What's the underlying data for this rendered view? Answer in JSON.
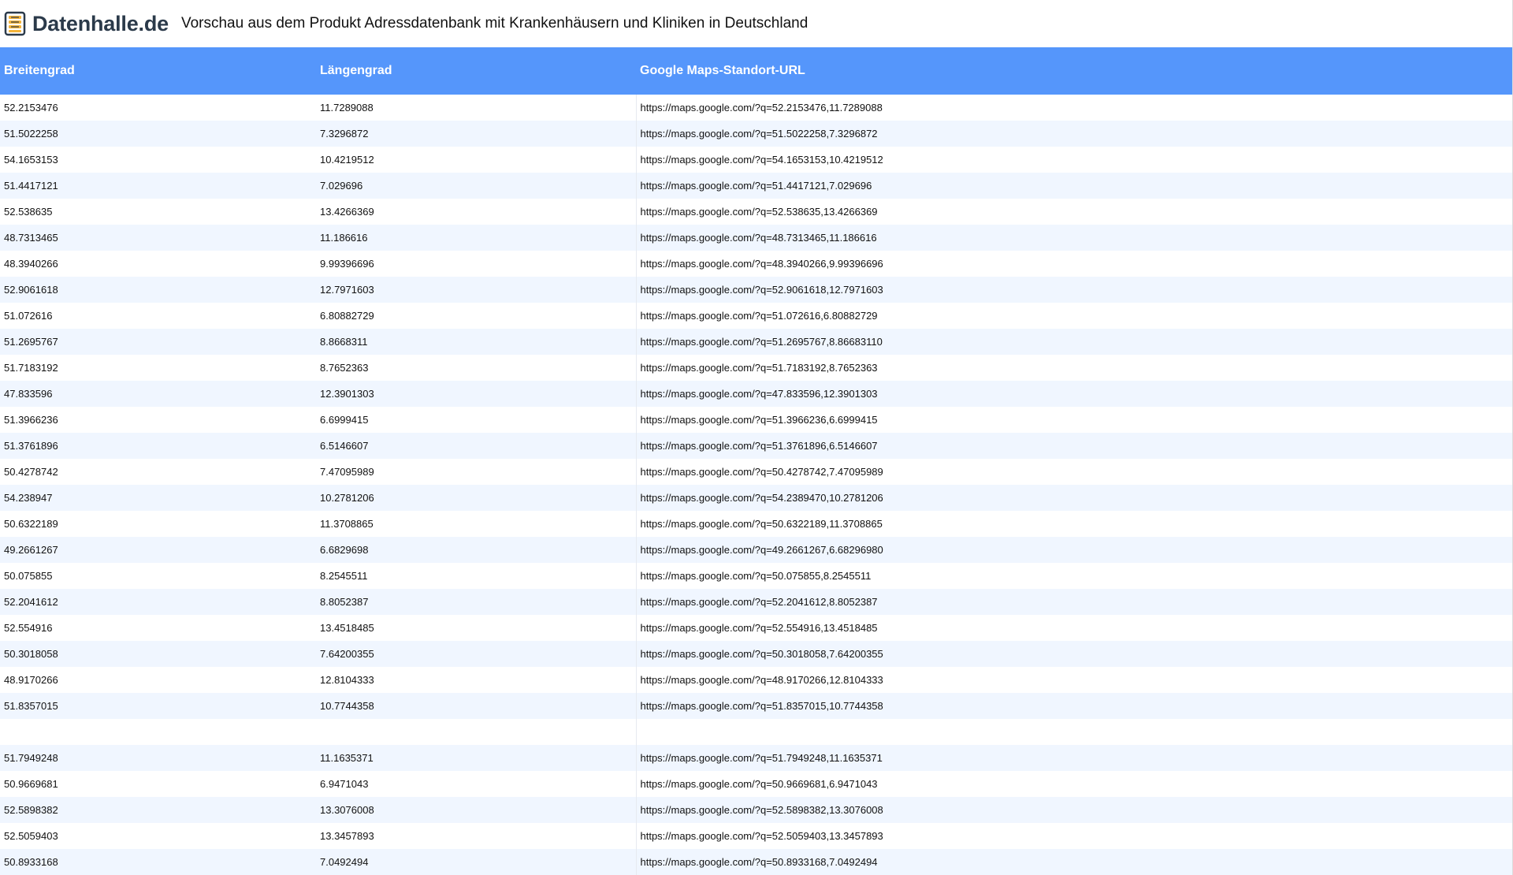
{
  "header": {
    "logo_text": "Datenhalle.de",
    "title": "Vorschau aus dem Produkt Adressdatenbank mit Krankenhäusern und Kliniken in Deutschland",
    "logo_icon": "database-stack-icon"
  },
  "colors": {
    "header_bg": "#5596fb",
    "row_alt": "#f0f6ff"
  },
  "table": {
    "columns": [
      "Breitengrad",
      "Längengrad",
      "Google Maps-Standort-URL"
    ],
    "rows": [
      [
        "52.2153476",
        "11.7289088",
        "https://maps.google.com/?q=52.2153476,11.7289088"
      ],
      [
        "51.5022258",
        "7.3296872",
        "https://maps.google.com/?q=51.5022258,7.3296872"
      ],
      [
        "54.1653153",
        "10.4219512",
        "https://maps.google.com/?q=54.1653153,10.4219512"
      ],
      [
        "51.4417121",
        "7.029696",
        "https://maps.google.com/?q=51.4417121,7.029696"
      ],
      [
        "52.538635",
        "13.4266369",
        "https://maps.google.com/?q=52.538635,13.4266369"
      ],
      [
        "48.7313465",
        "11.186616",
        "https://maps.google.com/?q=48.7313465,11.186616"
      ],
      [
        "48.3940266",
        "9.99396696",
        "https://maps.google.com/?q=48.3940266,9.99396696"
      ],
      [
        "52.9061618",
        "12.7971603",
        "https://maps.google.com/?q=52.9061618,12.7971603"
      ],
      [
        "51.072616",
        "6.80882729",
        "https://maps.google.com/?q=51.072616,6.80882729"
      ],
      [
        "51.2695767",
        "8.8668311",
        "https://maps.google.com/?q=51.2695767,8.86683110"
      ],
      [
        "51.7183192",
        "8.7652363",
        "https://maps.google.com/?q=51.7183192,8.7652363"
      ],
      [
        "47.833596",
        "12.3901303",
        "https://maps.google.com/?q=47.833596,12.3901303"
      ],
      [
        "51.3966236",
        "6.6999415",
        "https://maps.google.com/?q=51.3966236,6.6999415"
      ],
      [
        "51.3761896",
        "6.5146607",
        "https://maps.google.com/?q=51.3761896,6.5146607"
      ],
      [
        "50.4278742",
        "7.47095989",
        "https://maps.google.com/?q=50.4278742,7.47095989"
      ],
      [
        "54.238947",
        "10.2781206",
        "https://maps.google.com/?q=54.2389470,10.2781206"
      ],
      [
        "50.6322189",
        "11.3708865",
        "https://maps.google.com/?q=50.6322189,11.3708865"
      ],
      [
        "49.2661267",
        "6.6829698",
        "https://maps.google.com/?q=49.2661267,6.68296980"
      ],
      [
        "50.075855",
        "8.2545511",
        "https://maps.google.com/?q=50.075855,8.2545511"
      ],
      [
        "52.2041612",
        "8.8052387",
        "https://maps.google.com/?q=52.2041612,8.8052387"
      ],
      [
        "52.554916",
        "13.4518485",
        "https://maps.google.com/?q=52.554916,13.4518485"
      ],
      [
        "50.3018058",
        "7.64200355",
        "https://maps.google.com/?q=50.3018058,7.64200355"
      ],
      [
        "48.9170266",
        "12.8104333",
        "https://maps.google.com/?q=48.9170266,12.8104333"
      ],
      [
        "51.8357015",
        "10.7744358",
        "https://maps.google.com/?q=51.8357015,10.7744358"
      ],
      [
        "",
        "",
        ""
      ],
      [
        "51.7949248",
        "11.1635371",
        "https://maps.google.com/?q=51.7949248,11.1635371"
      ],
      [
        "50.9669681",
        "6.9471043",
        "https://maps.google.com/?q=50.9669681,6.9471043"
      ],
      [
        "52.5898382",
        "13.3076008",
        "https://maps.google.com/?q=52.5898382,13.3076008"
      ],
      [
        "52.5059403",
        "13.3457893",
        "https://maps.google.com/?q=52.5059403,13.3457893"
      ],
      [
        "50.8933168",
        "7.0492494",
        "https://maps.google.com/?q=50.8933168,7.0492494"
      ]
    ]
  }
}
